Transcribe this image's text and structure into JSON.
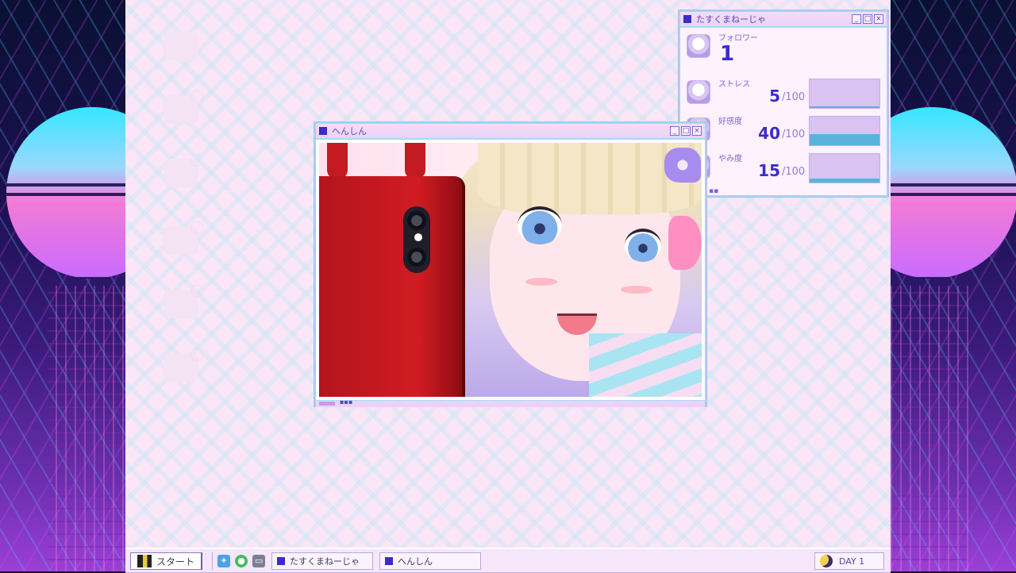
{
  "stats_window": {
    "title": "たすくまねーじゃ",
    "btn_min": "_",
    "btn_max": "□",
    "btn_close": "×",
    "follower": {
      "label": "フォロワー",
      "value": "1"
    },
    "stress": {
      "label": "ストレス",
      "value": "5",
      "max": "/100",
      "fraction": 0.05
    },
    "affection": {
      "label": "好感度",
      "value": "40",
      "max": "/100",
      "fraction": 0.4
    },
    "darkness": {
      "label": "やみ度",
      "value": "15",
      "max": "/100",
      "fraction": 0.15
    },
    "footer_dots": "▪▪"
  },
  "henshin_window": {
    "title": "へんしん",
    "btn_min": "_",
    "btn_max": "□",
    "btn_close": "×",
    "footer_dots": "▪▪▪"
  },
  "taskbar": {
    "start_label": "スタート",
    "tasks": [
      {
        "label": "たすくまねーじゃ"
      },
      {
        "label": "へんしん"
      }
    ],
    "day_label": "DAY 1"
  },
  "colors": {
    "accent": "#3d2bc8",
    "bar_fill": "#5ab3de",
    "bar_bg": "#d8c3f1",
    "window_border": "#9ad9f0"
  }
}
